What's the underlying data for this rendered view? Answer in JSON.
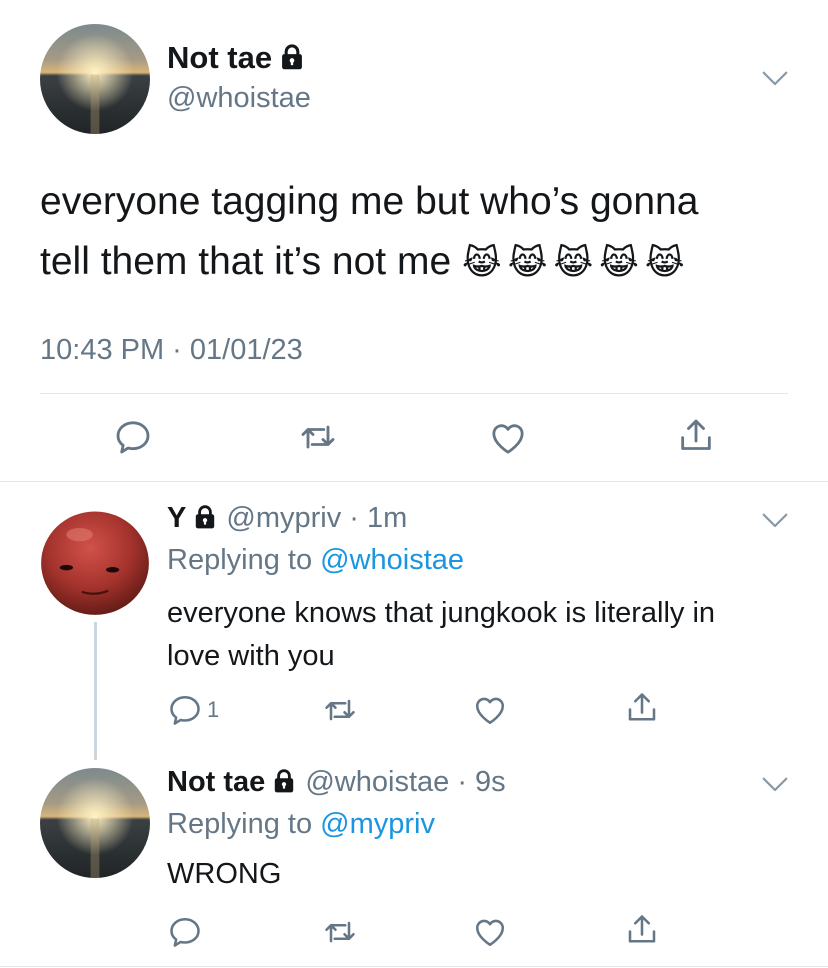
{
  "colors": {
    "text": "#14171a",
    "secondary": "#657786",
    "link": "#1b95e0",
    "divider": "#e1e8ed"
  },
  "main_tweet": {
    "display_name": "Not tae",
    "handle": "@whoistae",
    "lock_icon": "lock-icon",
    "text_line1": "everyone tagging me but who’s gonna",
    "text_line2": "tell them that it’s not me",
    "emojis": "😹😹😹😹😹",
    "timestamp": "10:43 PM · 01/01/23",
    "actions": [
      "reply-icon",
      "retweet-icon",
      "like-icon",
      "share-icon"
    ]
  },
  "replies": [
    {
      "display_name": "Y",
      "handle": "@mypriv",
      "time": "· 1m",
      "replying_label": "Replying to",
      "replying_to": "@whoistae",
      "text_line1": "everyone knows that jungkook is literally in",
      "text_line2": "love with you",
      "reply_count": "1"
    },
    {
      "display_name": "Not tae",
      "handle": "@whoistae",
      "time": "· 9s",
      "replying_label": "Replying to",
      "replying_to": "@mypriv",
      "text_line1": "WRONG"
    }
  ]
}
